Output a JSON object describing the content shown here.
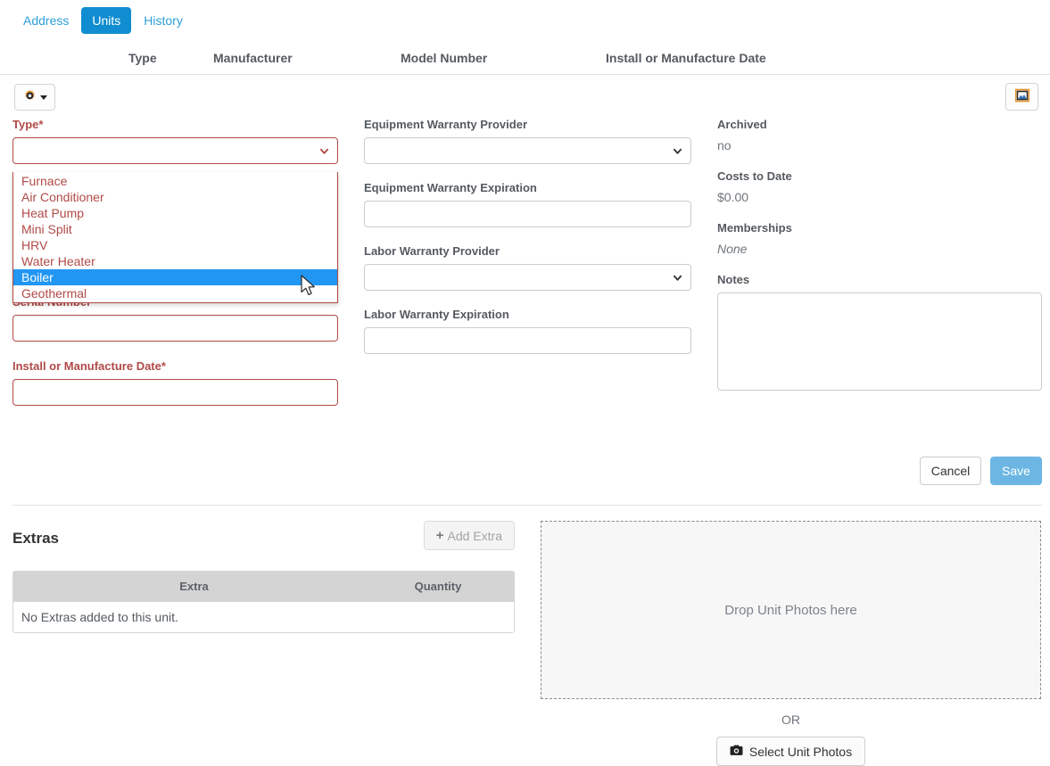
{
  "tabs": [
    {
      "label": "Address",
      "active": false
    },
    {
      "label": "Units",
      "active": true
    },
    {
      "label": "History",
      "active": false
    }
  ],
  "column_headers": {
    "type": "Type",
    "manufacturer": "Manufacturer",
    "model_number": "Model Number",
    "install_date": "Install or Manufacture Date"
  },
  "toolbar": {
    "gear_icon": "gear-icon",
    "gear_caret": "caret-down-icon",
    "photo_icon": "picture-icon"
  },
  "form": {
    "left": {
      "type_label": "Type*",
      "type_value": "",
      "type_options": [
        "Furnace",
        "Air Conditioner",
        "Heat Pump",
        "Mini Split",
        "HRV",
        "Water Heater",
        "Boiler",
        "Geothermal"
      ],
      "type_highlighted": "Boiler",
      "serial_label": "Serial Number*",
      "serial_value": "",
      "install_label": "Install or Manufacture Date*",
      "install_value": ""
    },
    "middle": {
      "equip_provider_label": "Equipment Warranty Provider",
      "equip_provider_value": "",
      "equip_expiration_label": "Equipment Warranty Expiration",
      "equip_expiration_value": "",
      "labor_provider_label": "Labor Warranty Provider",
      "labor_provider_value": "",
      "labor_expiration_label": "Labor Warranty Expiration",
      "labor_expiration_value": ""
    },
    "right": {
      "archived_label": "Archived",
      "archived_value": "no",
      "costs_label": "Costs to Date",
      "costs_value": "$0.00",
      "memberships_label": "Memberships",
      "memberships_value": "None",
      "notes_label": "Notes",
      "notes_value": ""
    }
  },
  "actions": {
    "cancel": "Cancel",
    "save": "Save"
  },
  "extras": {
    "title": "Extras",
    "add_button": "Add Extra",
    "add_icon": "plus-icon",
    "columns": [
      "Extra",
      "Quantity"
    ],
    "empty_message": "No Extras added to this unit."
  },
  "photos": {
    "dropzone_text": "Drop Unit Photos here",
    "or_text": "OR",
    "select_button": "Select Unit Photos",
    "camera_icon": "camera-icon"
  },
  "colors": {
    "tab_active": "#108dd0",
    "link": "#2d9fd9",
    "required": "#b04a47",
    "option_highlight": "#2196f3",
    "save": "#6cb6e3"
  }
}
